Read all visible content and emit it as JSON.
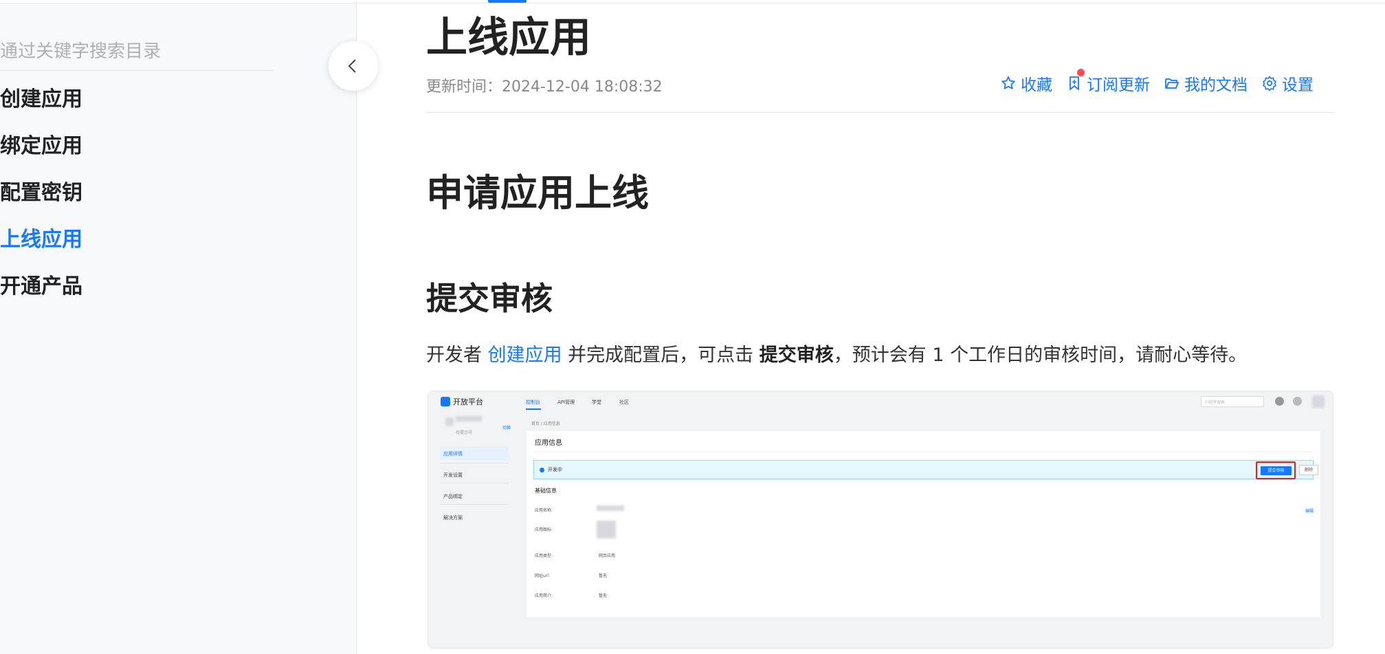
{
  "sidebar": {
    "search_placeholder": "通过关键字搜索目录",
    "items": [
      {
        "label": "创建应用",
        "active": false
      },
      {
        "label": "绑定应用",
        "active": false
      },
      {
        "label": "配置密钥",
        "active": false
      },
      {
        "label": "上线应用",
        "active": true
      },
      {
        "label": "开通产品",
        "active": false
      }
    ]
  },
  "header": {
    "title": "上线应用",
    "updated": "更新时间：2024-12-04 18:08:32",
    "actions": {
      "favorite": "收藏",
      "subscribe": "订阅更新",
      "my_docs": "我的文档",
      "settings": "设置"
    }
  },
  "content": {
    "h1": "申请应用上线",
    "h2": "提交审核",
    "para": {
      "prefix": "开发者 ",
      "link": "创建应用",
      "middle": " 并完成配置后，可点击 ",
      "bold": "提交审核",
      "suffix": "，预计会有 1 个工作日的审核时间，请耐心等待。"
    }
  },
  "screenshot": {
    "logo": "开放平台",
    "nav": [
      "控制台",
      "API管理",
      "学堂",
      "社区"
    ],
    "search_placeholder": "小程序搜索",
    "side": {
      "tag": "待提示号",
      "action": "切换",
      "items": [
        "应用详情",
        "开发设置",
        "产品绑定",
        "解决方案"
      ]
    },
    "breadcrumb": "首页 / 应用信息",
    "card_title": "应用信息",
    "status": "开发中",
    "submit": "提交审核",
    "delete": "删除",
    "section": "基础信息",
    "edit": "编辑",
    "fields": [
      {
        "label": "应用名称:",
        "value": ""
      },
      {
        "label": "应用图标:",
        "value": ""
      },
      {
        "label": "应用类型:",
        "value": "网页应用"
      },
      {
        "label": "网址url:",
        "value": "暂无"
      },
      {
        "label": "应用简介:",
        "value": "暂无"
      }
    ]
  },
  "colors": {
    "accent": "#1677ff",
    "highlight_box": "#e02020",
    "dot": "#ff4d4f"
  }
}
